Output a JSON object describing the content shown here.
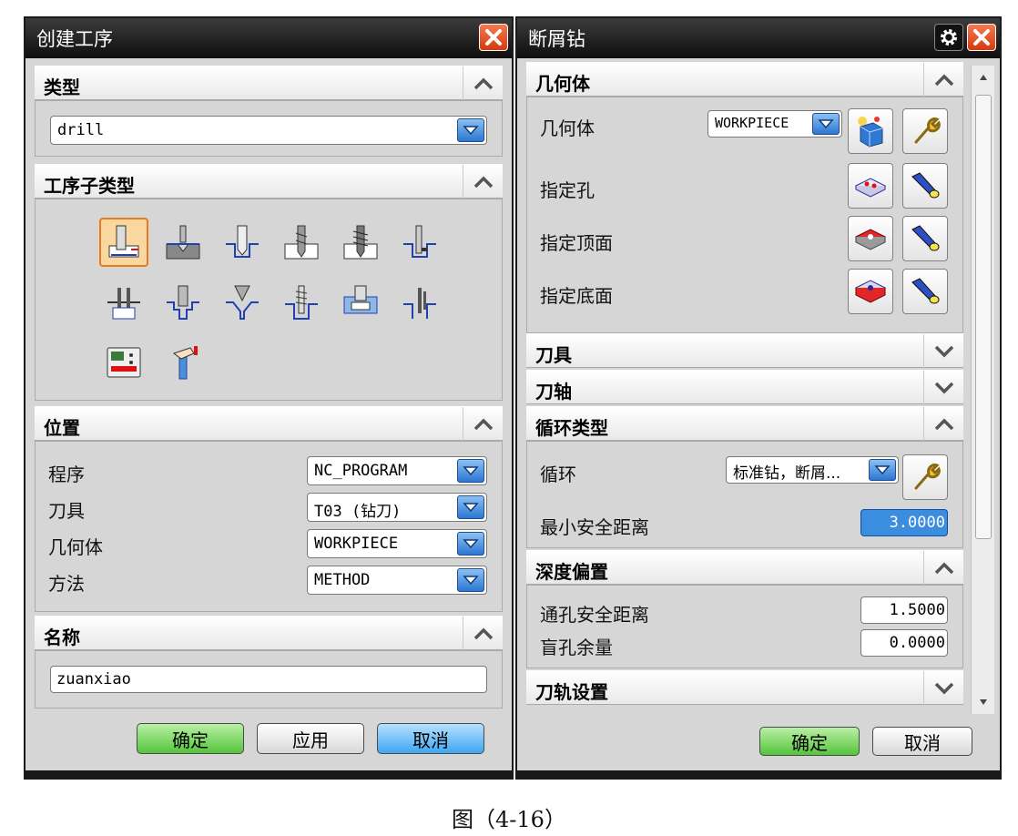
{
  "left_dialog": {
    "title": "创建工序",
    "type_section": {
      "title": "类型",
      "combo_value": "drill"
    },
    "subtype_section": {
      "title": "工序子类型"
    },
    "location_section": {
      "title": "位置",
      "rows": [
        {
          "label": "程序",
          "value": "NC_PROGRAM"
        },
        {
          "label": "刀具",
          "value": "T03 (钻刀)"
        },
        {
          "label": "几何体",
          "value": "WORKPIECE"
        },
        {
          "label": "方法",
          "value": "METHOD"
        }
      ]
    },
    "name_section": {
      "title": "名称",
      "value": "zuanxiao"
    },
    "buttons": {
      "ok": "确定",
      "apply": "应用",
      "cancel": "取消"
    }
  },
  "right_dialog": {
    "title": "断屑钻",
    "geometry_section": {
      "title": "几何体",
      "geometry_label": "几何体",
      "geometry_value": "WORKPIECE",
      "hole_label": "指定孔",
      "top_label": "指定顶面",
      "bottom_label": "指定底面"
    },
    "tool_section": {
      "title": "刀具"
    },
    "axis_section": {
      "title": "刀轴"
    },
    "cycle_section": {
      "title": "循环类型",
      "cycle_label": "循环",
      "cycle_value": "标准钻，断屑...",
      "clearance_label": "最小安全距离",
      "clearance_value": "3.0000"
    },
    "depth_section": {
      "title": "深度偏置",
      "through_label": "通孔安全距离",
      "through_value": "1.5000",
      "blind_label": "盲孔余量",
      "blind_value": "0.0000"
    },
    "path_section": {
      "title": "刀轨设置"
    },
    "buttons": {
      "ok": "确定",
      "cancel": "取消"
    }
  },
  "caption": "图（4-16）"
}
